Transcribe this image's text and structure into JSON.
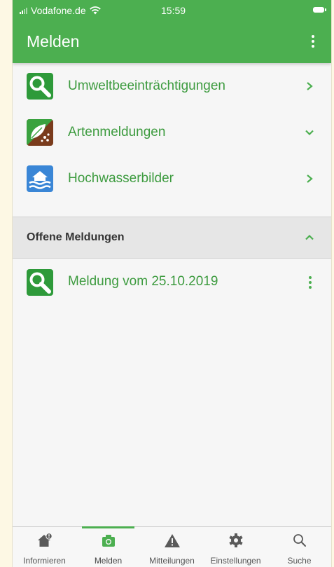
{
  "status_bar": {
    "carrier": "Vodafone.de",
    "time": "15:59"
  },
  "app_bar": {
    "title": "Melden"
  },
  "menu": {
    "items": [
      {
        "label": "Umweltbeeinträchtigungen",
        "icon": "magnifier-icon",
        "chevron": "right"
      },
      {
        "label": "Artenmeldungen",
        "icon": "leaf-species-icon",
        "chevron": "down"
      },
      {
        "label": "Hochwasserbilder",
        "icon": "flood-house-icon",
        "chevron": "right"
      }
    ]
  },
  "open_reports": {
    "title": "Offene Meldungen",
    "items": [
      {
        "label": "Meldung vom 25.10.2019",
        "icon": "magnifier-icon"
      }
    ]
  },
  "bottom_nav": {
    "items": [
      {
        "label": "Informieren",
        "icon": "house-info-icon"
      },
      {
        "label": "Melden",
        "icon": "camera-icon",
        "active": true
      },
      {
        "label": "Mitteilungen",
        "icon": "warning-icon"
      },
      {
        "label": "Einstellungen",
        "icon": "gear-icon"
      },
      {
        "label": "Suche",
        "icon": "search-icon"
      }
    ]
  },
  "colors": {
    "primary": "#4caf50",
    "link_text": "#3d9b3f",
    "magnifier_tile": "#2e9a3a",
    "species_tile_green": "#3aa23f",
    "species_tile_brown": "#7a3b1c",
    "flood_tile": "#3a86d6"
  }
}
